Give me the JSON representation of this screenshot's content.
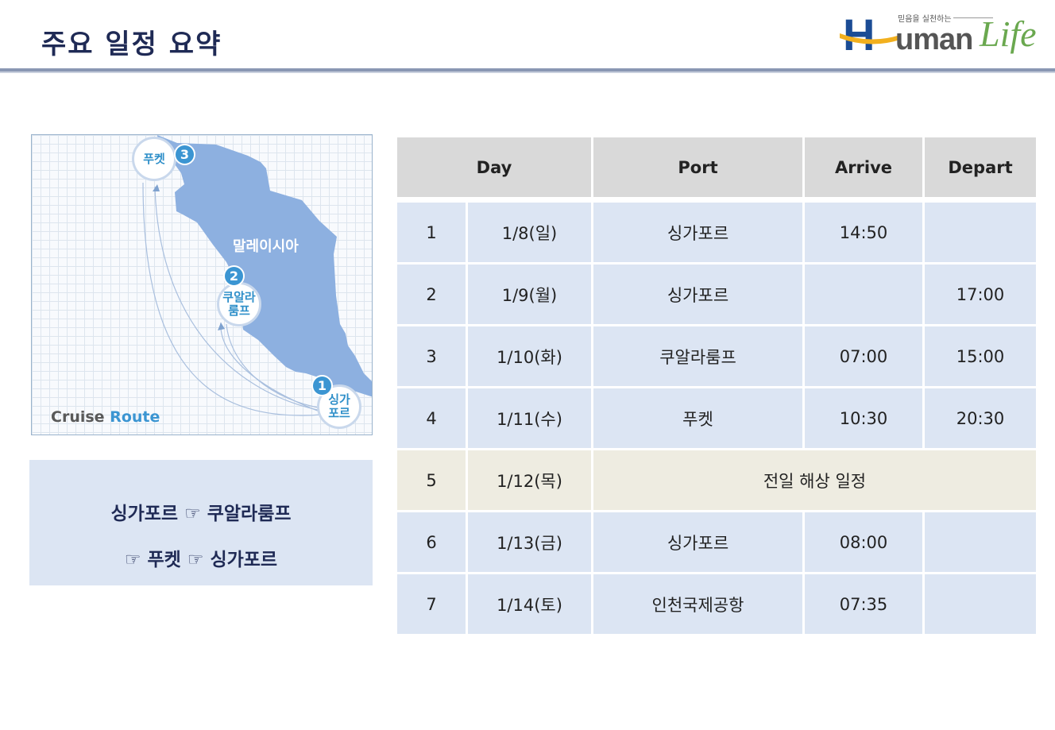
{
  "page": {
    "title": "주요 일정 요약"
  },
  "logo": {
    "tagline": "믿음을 실천하는",
    "letter_h": "H",
    "word_uman": "uman",
    "word_life": "Life"
  },
  "map": {
    "country": "말레이시아",
    "caption_part1": "Cruise",
    "caption_part2": "Route",
    "stops": [
      {
        "number": "1",
        "name_line1": "싱가",
        "name_line2": "포르"
      },
      {
        "number": "2",
        "name_line1": "쿠알라",
        "name_line2": "룸프"
      },
      {
        "number": "3",
        "name_line1": "푸켓",
        "name_line2": ""
      }
    ],
    "colors": {
      "land": "#8db0e0",
      "pin_text": "#2f8fc9",
      "badge": "#3b95d2",
      "route": "#a9bfde"
    }
  },
  "route_summary": {
    "line1": "싱가포르 ☞ 쿠알라룸프",
    "line2": "☞ 푸켓 ☞ 싱가포르"
  },
  "schedule": {
    "headers": {
      "day": "Day",
      "port": "Port",
      "arrive": "Arrive",
      "depart": "Depart"
    },
    "rows": [
      {
        "no": "1",
        "date": "1/8(일)",
        "port": "싱가포르",
        "arrive": "14:50",
        "depart": ""
      },
      {
        "no": "2",
        "date": "1/9(월)",
        "port": "싱가포르",
        "arrive": "",
        "depart": "17:00"
      },
      {
        "no": "3",
        "date": "1/10(화)",
        "port": "쿠알라룸프",
        "arrive": "07:00",
        "depart": "15:00"
      },
      {
        "no": "4",
        "date": "1/11(수)",
        "port": "푸켓",
        "arrive": "10:30",
        "depart": "20:30"
      },
      {
        "no": "5",
        "date": "1/12(목)",
        "note": "전일 해상 일정"
      },
      {
        "no": "6",
        "date": "1/13(금)",
        "port": "싱가포르",
        "arrive": "08:00",
        "depart": ""
      },
      {
        "no": "7",
        "date": "1/14(토)",
        "port": "인천국제공항",
        "arrive": "07:35",
        "depart": ""
      }
    ],
    "colors": {
      "header_bg": "#d9d9d9",
      "row_bg": "#dce5f3",
      "sea_row_bg": "#eeece1"
    }
  }
}
